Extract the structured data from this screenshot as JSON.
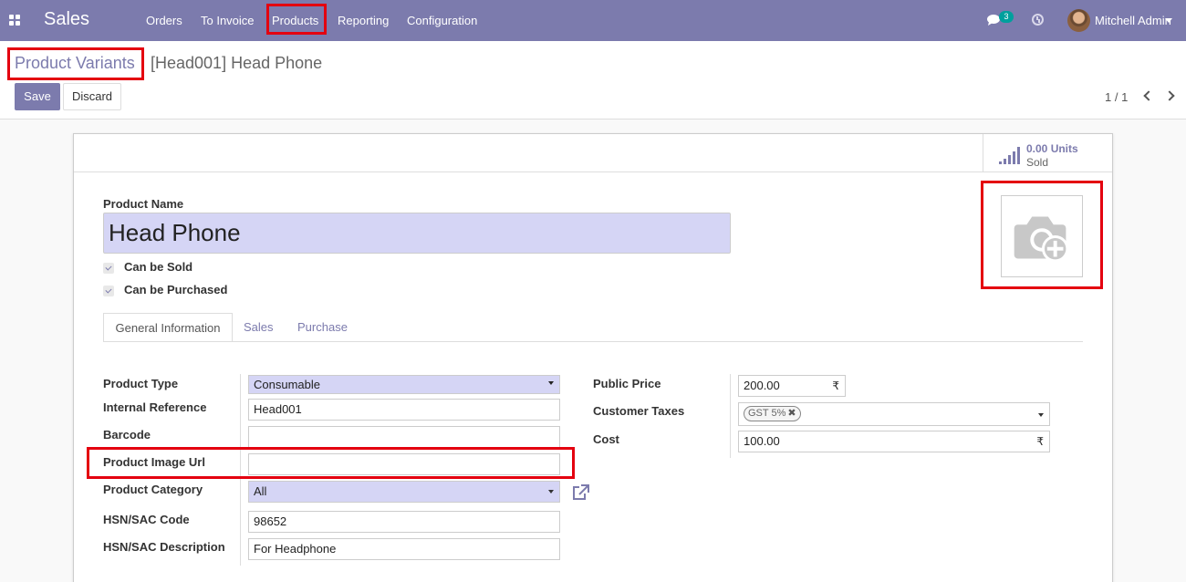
{
  "navbar": {
    "app_name": "Sales",
    "menu": [
      "Orders",
      "To Invoice",
      "Products",
      "Reporting",
      "Configuration"
    ],
    "chat_count": "3",
    "user_name": "Mitchell Admin",
    "accent_color": "#7c7bad"
  },
  "breadcrumb": {
    "parent": "Product Variants",
    "current": "[Head001] Head Phone"
  },
  "buttons": {
    "save": "Save",
    "discard": "Discard"
  },
  "pager": {
    "value": "1 / 1"
  },
  "stat": {
    "value": "0.00 Units",
    "label": "Sold"
  },
  "product": {
    "name_label": "Product Name",
    "name": "Head Phone",
    "can_be_sold": "Can be Sold",
    "can_be_purchased": "Can be Purchased"
  },
  "tabs": [
    "General Information",
    "Sales",
    "Purchase"
  ],
  "left_fields": {
    "product_type_label": "Product Type",
    "product_type": "Consumable",
    "internal_reference_label": "Internal Reference",
    "internal_reference": "Head001",
    "barcode_label": "Barcode",
    "barcode": "",
    "image_url_label": "Product Image Url",
    "image_url": "",
    "category_label": "Product Category",
    "category": "All",
    "hsn_code_label": "HSN/SAC Code",
    "hsn_code": "98652",
    "hsn_desc_label": "HSN/SAC Description",
    "hsn_desc": "For Headphone"
  },
  "right_fields": {
    "public_price_label": "Public Price",
    "public_price": "200.00",
    "customer_taxes_label": "Customer Taxes",
    "customer_tax_tag": "GST 5%",
    "cost_label": "Cost",
    "cost": "100.00",
    "currency_symbol": "₹"
  },
  "icons": [
    "apps-icon",
    "chat-icon",
    "clock-icon",
    "bar-chart-icon",
    "camera-add-icon",
    "external-link-icon",
    "chevron-left-icon",
    "chevron-right-icon"
  ],
  "highlight_color": "#e4000f"
}
